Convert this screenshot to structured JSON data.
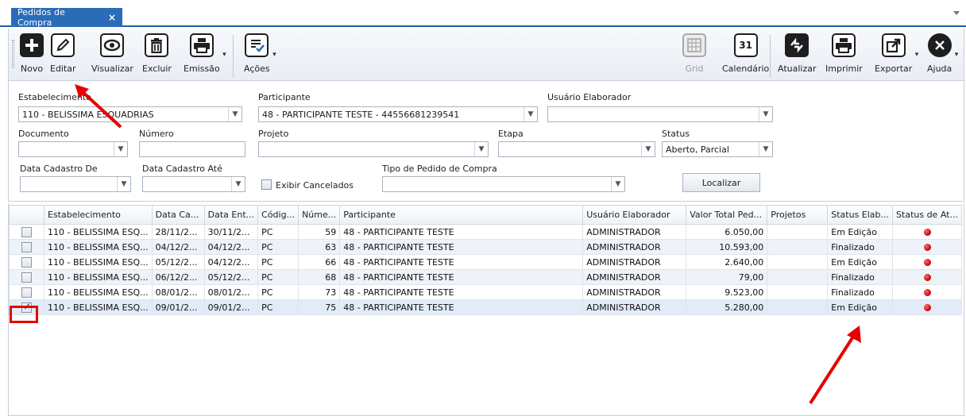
{
  "tab": {
    "title": "Pedidos de Compra",
    "close": "×"
  },
  "toolbar": {
    "novo": "Novo",
    "editar": "Editar",
    "visualizar": "Visualizar",
    "excluir": "Excluir",
    "emissao": "Emissão",
    "acoes": "Ações",
    "grid": "Grid",
    "calendario": "Calendário",
    "calendar_day": "31",
    "atualizar": "Atualizar",
    "imprimir": "Imprimir",
    "exportar": "Exportar",
    "ajuda": "Ajuda"
  },
  "filters": {
    "estabelecimento_label": "Estabelecimento",
    "estabelecimento_value": "110 - BELISSIMA ESQUADRIAS",
    "participante_label": "Participante",
    "participante_value": "48 - PARTICIPANTE TESTE - 44556681239541",
    "usuario_label": "Usuário Elaborador",
    "usuario_value": "",
    "documento_label": "Documento",
    "numero_label": "Número",
    "projeto_label": "Projeto",
    "etapa_label": "Etapa",
    "status_label": "Status",
    "status_value": "Aberto, Parcial",
    "data_cadastro_de_label": "Data Cadastro De",
    "data_cadastro_ate_label": "Data Cadastro Até",
    "exibir_cancelados_label": "Exibir Cancelados",
    "tipo_pedido_label": "Tipo de Pedido de Compra",
    "localizar": "Localizar"
  },
  "grid": {
    "columns": [
      "",
      "Estabelecimento",
      "Data Ca...",
      "Data Ent...",
      "Códig...",
      "Núme...",
      "Participante",
      "Usuário Elaborador",
      "Valor Total Ped...",
      "Projetos",
      "Status Elab...",
      "Status de At..."
    ],
    "rows": [
      {
        "checked": false,
        "estab": "110 - BELISSIMA ESQ...",
        "data_cad": "28/11/2...",
        "data_ent": "30/11/2...",
        "codigo": "PC",
        "numero": "59",
        "participante": "48 - PARTICIPANTE TESTE",
        "usuario": "ADMINISTRADOR",
        "valor": "6.050,00",
        "projetos": "",
        "status_elab": "Em Edição"
      },
      {
        "checked": false,
        "estab": "110 - BELISSIMA ESQ...",
        "data_cad": "04/12/2...",
        "data_ent": "04/12/2...",
        "codigo": "PC",
        "numero": "63",
        "participante": "48 - PARTICIPANTE TESTE",
        "usuario": "ADMINISTRADOR",
        "valor": "10.593,00",
        "projetos": "",
        "status_elab": "Finalizado"
      },
      {
        "checked": false,
        "estab": "110 - BELISSIMA ESQ...",
        "data_cad": "05/12/2...",
        "data_ent": "04/12/2...",
        "codigo": "PC",
        "numero": "66",
        "participante": "48 - PARTICIPANTE TESTE",
        "usuario": "ADMINISTRADOR",
        "valor": "2.640,00",
        "projetos": "",
        "status_elab": "Em Edição"
      },
      {
        "checked": false,
        "estab": "110 - BELISSIMA ESQ...",
        "data_cad": "06/12/2...",
        "data_ent": "05/12/2...",
        "codigo": "PC",
        "numero": "68",
        "participante": "48 - PARTICIPANTE TESTE",
        "usuario": "ADMINISTRADOR",
        "valor": "79,00",
        "projetos": "",
        "status_elab": "Finalizado"
      },
      {
        "checked": false,
        "estab": "110 - BELISSIMA ESQ...",
        "data_cad": "08/01/2...",
        "data_ent": "08/01/2...",
        "codigo": "PC",
        "numero": "73",
        "participante": "48 - PARTICIPANTE TESTE",
        "usuario": "ADMINISTRADOR",
        "valor": "9.523,00",
        "projetos": "",
        "status_elab": "Finalizado"
      },
      {
        "checked": true,
        "estab": "110 - BELISSIMA ESQ...",
        "data_cad": "09/01/2...",
        "data_ent": "09/01/2...",
        "codigo": "PC",
        "numero": "75",
        "participante": "48 - PARTICIPANTE TESTE",
        "usuario": "ADMINISTRADOR",
        "valor": "5.280,00",
        "projetos": "",
        "status_elab": "Em Edição"
      }
    ]
  },
  "colors": {
    "tab_blue": "#2a6cb8",
    "annotation_red": "#e60000",
    "status_dot": "#c20000"
  }
}
